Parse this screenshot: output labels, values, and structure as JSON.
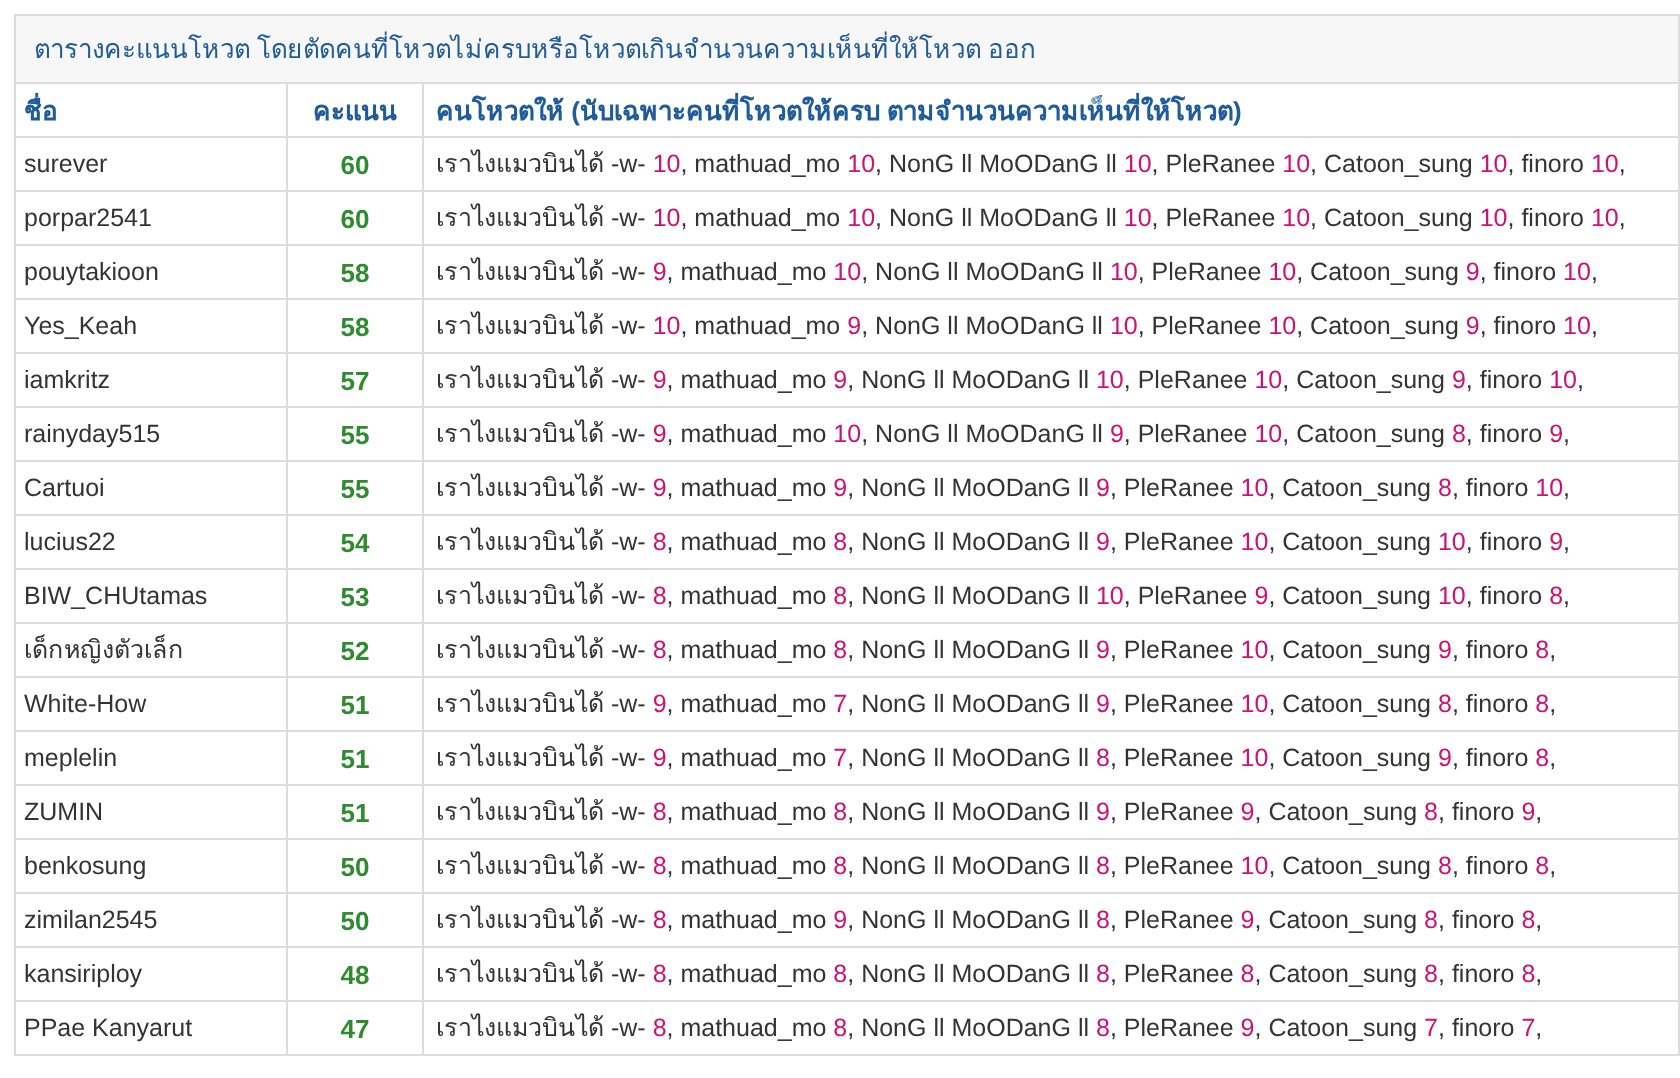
{
  "table": {
    "title": "ตารางคะแนนโหวต โดยตัดคนที่โหวตไม่ครบหรือโหวตเกินจำนวนความเห็นที่ให้โหวต ออก",
    "columns": [
      "ชื่อ",
      "คะแนน",
      "คนโหวตให้ (นับเฉพาะคนที่โหวตให้ครบ ตามจำนวนความเห็นที่ให้โหวต)"
    ],
    "rows": [
      {
        "name": "surever",
        "score": "60",
        "votes": [
          {
            "voter": "เราไงแมวบินได้ -w-",
            "points": "10",
            "sep": ","
          },
          {
            "voter": "mathuad_mo",
            "points": "10",
            "sep": ","
          },
          {
            "voter": "NonG ll MoODanG ll",
            "points": "10",
            "sep": ","
          },
          {
            "voter": "PleRanee",
            "points": "10",
            "sep": ","
          },
          {
            "voter": "Catoon_sung",
            "points": "10",
            "sep": ","
          },
          {
            "voter": "finoro",
            "points": "10",
            "sep": ","
          }
        ]
      },
      {
        "name": "porpar2541",
        "score": "60",
        "votes": [
          {
            "voter": "เราไงแมวบินได้ -w-",
            "points": "10",
            "sep": ","
          },
          {
            "voter": "mathuad_mo",
            "points": "10",
            "sep": ","
          },
          {
            "voter": "NonG ll MoODanG ll",
            "points": "10",
            "sep": ","
          },
          {
            "voter": "PleRanee",
            "points": "10",
            "sep": ","
          },
          {
            "voter": "Catoon_sung",
            "points": "10",
            "sep": ","
          },
          {
            "voter": "finoro",
            "points": "10",
            "sep": ","
          }
        ]
      },
      {
        "name": "pouytakioon",
        "score": "58",
        "votes": [
          {
            "voter": "เราไงแมวบินได้ -w-",
            "points": "9",
            "sep": ","
          },
          {
            "voter": "mathuad_mo",
            "points": "10",
            "sep": ","
          },
          {
            "voter": "NonG ll MoODanG ll",
            "points": "10",
            "sep": ","
          },
          {
            "voter": "PleRanee",
            "points": "10",
            "sep": ","
          },
          {
            "voter": "Catoon_sung",
            "points": "9",
            "sep": ","
          },
          {
            "voter": "finoro",
            "points": "10",
            "sep": ","
          }
        ]
      },
      {
        "name": "Yes_Keah",
        "score": "58",
        "votes": [
          {
            "voter": "เราไงแมวบินได้ -w-",
            "points": "10",
            "sep": ","
          },
          {
            "voter": "mathuad_mo",
            "points": "9",
            "sep": ","
          },
          {
            "voter": "NonG ll MoODanG ll",
            "points": "10",
            "sep": ","
          },
          {
            "voter": "PleRanee",
            "points": "10",
            "sep": ","
          },
          {
            "voter": "Catoon_sung",
            "points": "9",
            "sep": ","
          },
          {
            "voter": "finoro",
            "points": "10",
            "sep": ","
          }
        ]
      },
      {
        "name": "iamkritz",
        "score": "57",
        "votes": [
          {
            "voter": "เราไงแมวบินได้ -w-",
            "points": "9",
            "sep": ","
          },
          {
            "voter": "mathuad_mo",
            "points": "9",
            "sep": ","
          },
          {
            "voter": "NonG ll MoODanG ll",
            "points": "10",
            "sep": ","
          },
          {
            "voter": "PleRanee",
            "points": "10",
            "sep": ","
          },
          {
            "voter": "Catoon_sung",
            "points": "9",
            "sep": ","
          },
          {
            "voter": "finoro",
            "points": "10",
            "sep": ","
          }
        ]
      },
      {
        "name": "rainyday515",
        "score": "55",
        "votes": [
          {
            "voter": "เราไงแมวบินได้ -w-",
            "points": "9",
            "sep": ","
          },
          {
            "voter": "mathuad_mo",
            "points": "10",
            "sep": ","
          },
          {
            "voter": "NonG ll MoODanG ll",
            "points": "9",
            "sep": ","
          },
          {
            "voter": "PleRanee",
            "points": "10",
            "sep": ","
          },
          {
            "voter": "Catoon_sung",
            "points": "8",
            "sep": ","
          },
          {
            "voter": "finoro",
            "points": "9",
            "sep": ","
          }
        ]
      },
      {
        "name": "Cartuoi",
        "score": "55",
        "votes": [
          {
            "voter": "เราไงแมวบินได้ -w-",
            "points": "9",
            "sep": ","
          },
          {
            "voter": "mathuad_mo",
            "points": "9",
            "sep": ","
          },
          {
            "voter": "NonG ll MoODanG ll",
            "points": "9",
            "sep": ","
          },
          {
            "voter": "PleRanee",
            "points": "10",
            "sep": ","
          },
          {
            "voter": "Catoon_sung",
            "points": "8",
            "sep": ","
          },
          {
            "voter": "finoro",
            "points": "10",
            "sep": ","
          }
        ]
      },
      {
        "name": "lucius22",
        "score": "54",
        "votes": [
          {
            "voter": "เราไงแมวบินได้ -w-",
            "points": "8",
            "sep": ","
          },
          {
            "voter": "mathuad_mo",
            "points": "8",
            "sep": ","
          },
          {
            "voter": "NonG ll MoODanG ll",
            "points": "9",
            "sep": ","
          },
          {
            "voter": "PleRanee",
            "points": "10",
            "sep": ","
          },
          {
            "voter": "Catoon_sung",
            "points": "10",
            "sep": ","
          },
          {
            "voter": "finoro",
            "points": "9",
            "sep": ","
          }
        ]
      },
      {
        "name": "BIW_CHUtamas",
        "score": "53",
        "votes": [
          {
            "voter": "เราไงแมวบินได้ -w-",
            "points": "8",
            "sep": ","
          },
          {
            "voter": "mathuad_mo",
            "points": "8",
            "sep": ","
          },
          {
            "voter": "NonG ll MoODanG ll",
            "points": "10",
            "sep": ","
          },
          {
            "voter": "PleRanee",
            "points": "9",
            "sep": ","
          },
          {
            "voter": "Catoon_sung",
            "points": "10",
            "sep": ","
          },
          {
            "voter": "finoro",
            "points": "8",
            "sep": ","
          }
        ]
      },
      {
        "name": "เด็กหญิงตัวเล็ก",
        "score": "52",
        "votes": [
          {
            "voter": "เราไงแมวบินได้ -w-",
            "points": "8",
            "sep": ","
          },
          {
            "voter": "mathuad_mo",
            "points": "8",
            "sep": ","
          },
          {
            "voter": "NonG ll MoODanG ll",
            "points": "9",
            "sep": ","
          },
          {
            "voter": "PleRanee",
            "points": "10",
            "sep": ","
          },
          {
            "voter": "Catoon_sung",
            "points": "9",
            "sep": ","
          },
          {
            "voter": "finoro",
            "points": "8",
            "sep": ","
          }
        ]
      },
      {
        "name": "White-How",
        "score": "51",
        "votes": [
          {
            "voter": "เราไงแมวบินได้ -w-",
            "points": "9",
            "sep": ","
          },
          {
            "voter": "mathuad_mo",
            "points": "7",
            "sep": ","
          },
          {
            "voter": "NonG ll MoODanG ll",
            "points": "9",
            "sep": ","
          },
          {
            "voter": "PleRanee",
            "points": "10",
            "sep": ","
          },
          {
            "voter": "Catoon_sung",
            "points": "8",
            "sep": ","
          },
          {
            "voter": "finoro",
            "points": "8",
            "sep": ","
          }
        ]
      },
      {
        "name": "meplelin",
        "score": "51",
        "votes": [
          {
            "voter": "เราไงแมวบินได้ -w-",
            "points": "9",
            "sep": ","
          },
          {
            "voter": "mathuad_mo",
            "points": "7",
            "sep": ","
          },
          {
            "voter": "NonG ll MoODanG ll",
            "points": "8",
            "sep": ","
          },
          {
            "voter": "PleRanee",
            "points": "10",
            "sep": ","
          },
          {
            "voter": "Catoon_sung",
            "points": "9",
            "sep": ","
          },
          {
            "voter": "finoro",
            "points": "8",
            "sep": ","
          }
        ]
      },
      {
        "name": "ZUMIN",
        "score": "51",
        "votes": [
          {
            "voter": "เราไงแมวบินได้ -w-",
            "points": "8",
            "sep": ","
          },
          {
            "voter": "mathuad_mo",
            "points": "8",
            "sep": ","
          },
          {
            "voter": "NonG ll MoODanG ll",
            "points": "9",
            "sep": ","
          },
          {
            "voter": "PleRanee",
            "points": "9",
            "sep": ","
          },
          {
            "voter": "Catoon_sung",
            "points": "8",
            "sep": ","
          },
          {
            "voter": "finoro",
            "points": "9",
            "sep": ","
          }
        ]
      },
      {
        "name": "benkosung",
        "score": "50",
        "votes": [
          {
            "voter": "เราไงแมวบินได้ -w-",
            "points": "8",
            "sep": ","
          },
          {
            "voter": "mathuad_mo",
            "points": "8",
            "sep": ","
          },
          {
            "voter": "NonG ll MoODanG ll",
            "points": "8",
            "sep": ","
          },
          {
            "voter": "PleRanee",
            "points": "10",
            "sep": ","
          },
          {
            "voter": "Catoon_sung",
            "points": "8",
            "sep": ","
          },
          {
            "voter": "finoro",
            "points": "8",
            "sep": ","
          }
        ]
      },
      {
        "name": "zimilan2545",
        "score": "50",
        "votes": [
          {
            "voter": "เราไงแมวบินได้ -w-",
            "points": "8",
            "sep": ","
          },
          {
            "voter": "mathuad_mo",
            "points": "9",
            "sep": ","
          },
          {
            "voter": "NonG ll MoODanG ll",
            "points": "8",
            "sep": ","
          },
          {
            "voter": "PleRanee",
            "points": "9",
            "sep": ","
          },
          {
            "voter": "Catoon_sung",
            "points": "8",
            "sep": ","
          },
          {
            "voter": "finoro",
            "points": "8",
            "sep": ","
          }
        ]
      },
      {
        "name": "kansiriploy",
        "score": "48",
        "votes": [
          {
            "voter": "เราไงแมวบินได้ -w-",
            "points": "8",
            "sep": ","
          },
          {
            "voter": "mathuad_mo",
            "points": "8",
            "sep": ","
          },
          {
            "voter": "NonG ll MoODanG ll",
            "points": "8",
            "sep": ","
          },
          {
            "voter": "PleRanee",
            "points": "8",
            "sep": ","
          },
          {
            "voter": "Catoon_sung",
            "points": "8",
            "sep": ","
          },
          {
            "voter": "finoro",
            "points": "8",
            "sep": ","
          }
        ]
      },
      {
        "name": "PPae Kanyarut",
        "score": "47",
        "votes": [
          {
            "voter": "เราไงแมวบินได้ -w-",
            "points": "8",
            "sep": ","
          },
          {
            "voter": "mathuad_mo",
            "points": "8",
            "sep": ","
          },
          {
            "voter": "NonG ll MoODanG ll",
            "points": "8",
            "sep": ","
          },
          {
            "voter": "PleRanee",
            "points": "9",
            "sep": ","
          },
          {
            "voter": "Catoon_sung",
            "points": "7",
            "sep": ","
          },
          {
            "voter": "finoro",
            "points": "7",
            "sep": ","
          }
        ]
      }
    ]
  }
}
